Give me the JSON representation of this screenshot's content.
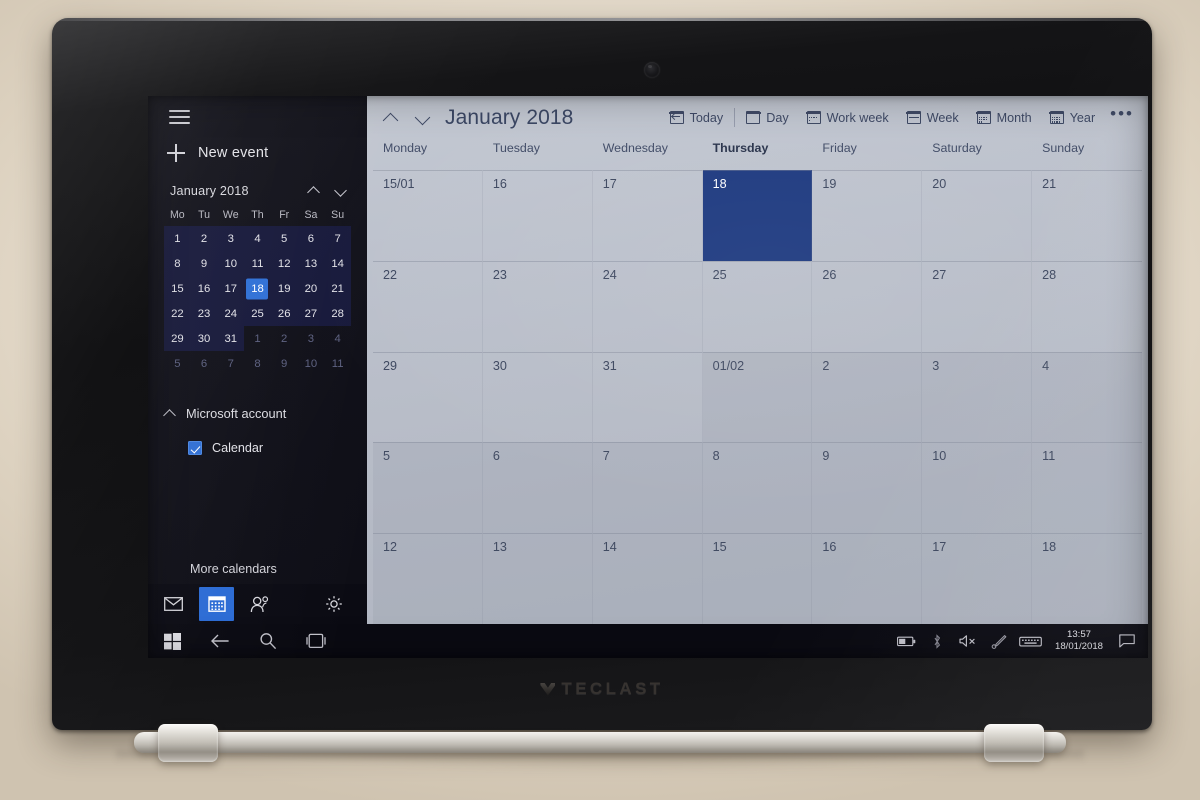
{
  "device": {
    "brand": "TECLAST",
    "logo_icon": "teclast-logo-mark",
    "webcam_icon": "webcam-lens"
  },
  "app": {
    "name": "Windows Calendar",
    "sidebar": {
      "menu_icon": "hamburger-menu-icon",
      "new_event": {
        "label": "New event",
        "icon": "plus-icon"
      },
      "mini_calendar": {
        "title": "January 2018",
        "prev_icon": "chevron-up-icon",
        "next_icon": "chevron-down-icon",
        "day_initials": [
          "Mo",
          "Tu",
          "We",
          "Th",
          "Fr",
          "Sa",
          "Su"
        ],
        "weeks": [
          [
            {
              "d": "1",
              "month": "in"
            },
            {
              "d": "2",
              "month": "in"
            },
            {
              "d": "3",
              "month": "in"
            },
            {
              "d": "4",
              "month": "in"
            },
            {
              "d": "5",
              "month": "in"
            },
            {
              "d": "6",
              "month": "in"
            },
            {
              "d": "7",
              "month": "in"
            }
          ],
          [
            {
              "d": "8",
              "month": "in"
            },
            {
              "d": "9",
              "month": "in"
            },
            {
              "d": "10",
              "month": "in"
            },
            {
              "d": "11",
              "month": "in"
            },
            {
              "d": "12",
              "month": "in"
            },
            {
              "d": "13",
              "month": "in"
            },
            {
              "d": "14",
              "month": "in"
            }
          ],
          [
            {
              "d": "15",
              "month": "in"
            },
            {
              "d": "16",
              "month": "in"
            },
            {
              "d": "17",
              "month": "in"
            },
            {
              "d": "18",
              "month": "in",
              "selected": true
            },
            {
              "d": "19",
              "month": "in"
            },
            {
              "d": "20",
              "month": "in"
            },
            {
              "d": "21",
              "month": "in"
            }
          ],
          [
            {
              "d": "22",
              "month": "in"
            },
            {
              "d": "23",
              "month": "in"
            },
            {
              "d": "24",
              "month": "in"
            },
            {
              "d": "25",
              "month": "in"
            },
            {
              "d": "26",
              "month": "in"
            },
            {
              "d": "27",
              "month": "in"
            },
            {
              "d": "28",
              "month": "in"
            }
          ],
          [
            {
              "d": "29",
              "month": "in"
            },
            {
              "d": "30",
              "month": "in"
            },
            {
              "d": "31",
              "month": "in"
            },
            {
              "d": "1",
              "month": "out"
            },
            {
              "d": "2",
              "month": "out"
            },
            {
              "d": "3",
              "month": "out"
            },
            {
              "d": "4",
              "month": "out"
            }
          ],
          [
            {
              "d": "5",
              "month": "out"
            },
            {
              "d": "6",
              "month": "out"
            },
            {
              "d": "7",
              "month": "out"
            },
            {
              "d": "8",
              "month": "out"
            },
            {
              "d": "9",
              "month": "out"
            },
            {
              "d": "10",
              "month": "out"
            },
            {
              "d": "11",
              "month": "out"
            }
          ]
        ]
      },
      "account": {
        "label": "Microsoft account",
        "expand_icon": "chevron-up-icon"
      },
      "calendar_checkbox": {
        "label": "Calendar",
        "checked": true
      },
      "more_calendars": {
        "label": "More calendars"
      },
      "bottom_nav": [
        {
          "name": "mail",
          "icon": "mail-icon",
          "active": false
        },
        {
          "name": "calendar",
          "icon": "calendar-icon",
          "active": true
        },
        {
          "name": "people",
          "icon": "people-icon",
          "active": false
        },
        {
          "name": "settings",
          "icon": "gear-icon",
          "active": false
        }
      ]
    },
    "toolbar": {
      "prev_icon": "chevron-up-icon",
      "next_icon": "chevron-down-icon",
      "title": "January 2018",
      "today": "Today",
      "day": "Day",
      "work_week": "Work week",
      "week": "Week",
      "month": "Month",
      "year": "Year",
      "more": "•••",
      "active_view": "Month"
    },
    "calendar": {
      "day_headers": [
        "Monday",
        "Tuesday",
        "Wednesday",
        "Thursday",
        "Friday",
        "Saturday",
        "Sunday"
      ],
      "today_header": "Thursday",
      "weeks": [
        [
          {
            "label": "15/01",
            "state": "in"
          },
          {
            "label": "16",
            "state": "in"
          },
          {
            "label": "17",
            "state": "in"
          },
          {
            "label": "18",
            "state": "selected"
          },
          {
            "label": "19",
            "state": "in"
          },
          {
            "label": "20",
            "state": "in"
          },
          {
            "label": "21",
            "state": "in"
          }
        ],
        [
          {
            "label": "22",
            "state": "in"
          },
          {
            "label": "23",
            "state": "in"
          },
          {
            "label": "24",
            "state": "in"
          },
          {
            "label": "25",
            "state": "in"
          },
          {
            "label": "26",
            "state": "in"
          },
          {
            "label": "27",
            "state": "in"
          },
          {
            "label": "28",
            "state": "in"
          }
        ],
        [
          {
            "label": "29",
            "state": "in"
          },
          {
            "label": "30",
            "state": "in"
          },
          {
            "label": "31",
            "state": "in"
          },
          {
            "label": "01/02",
            "state": "out"
          },
          {
            "label": "2",
            "state": "out"
          },
          {
            "label": "3",
            "state": "out"
          },
          {
            "label": "4",
            "state": "out"
          }
        ],
        [
          {
            "label": "5",
            "state": "out"
          },
          {
            "label": "6",
            "state": "out"
          },
          {
            "label": "7",
            "state": "out"
          },
          {
            "label": "8",
            "state": "out"
          },
          {
            "label": "9",
            "state": "out"
          },
          {
            "label": "10",
            "state": "out"
          },
          {
            "label": "11",
            "state": "out"
          }
        ],
        [
          {
            "label": "12",
            "state": "out"
          },
          {
            "label": "13",
            "state": "out"
          },
          {
            "label": "14",
            "state": "out"
          },
          {
            "label": "15",
            "state": "out"
          },
          {
            "label": "16",
            "state": "out"
          },
          {
            "label": "17",
            "state": "out"
          },
          {
            "label": "18",
            "state": "out"
          }
        ]
      ]
    }
  },
  "taskbar": {
    "start_icon": "windows-start-icon",
    "back_icon": "back-arrow-icon",
    "search_icon": "search-icon",
    "task_view_icon": "task-view-icon",
    "tray": [
      {
        "name": "battery",
        "icon": "battery-icon"
      },
      {
        "name": "bluetooth",
        "icon": "bluetooth-icon"
      },
      {
        "name": "volume-muted",
        "icon": "speaker-mute-icon"
      },
      {
        "name": "pen",
        "icon": "pen-icon"
      },
      {
        "name": "keyboard",
        "icon": "keyboard-icon"
      }
    ],
    "clock": {
      "time": "13:57",
      "date": "18/01/2018"
    },
    "action_center_icon": "action-center-icon"
  },
  "colors": {
    "accent_blue": "#2e6fd6",
    "selected_day_blue": "#1e3a80",
    "sidebar_bg": "#101019",
    "calendar_bg": "#bcc1cc",
    "taskbar_bg": "#0a0a12"
  }
}
